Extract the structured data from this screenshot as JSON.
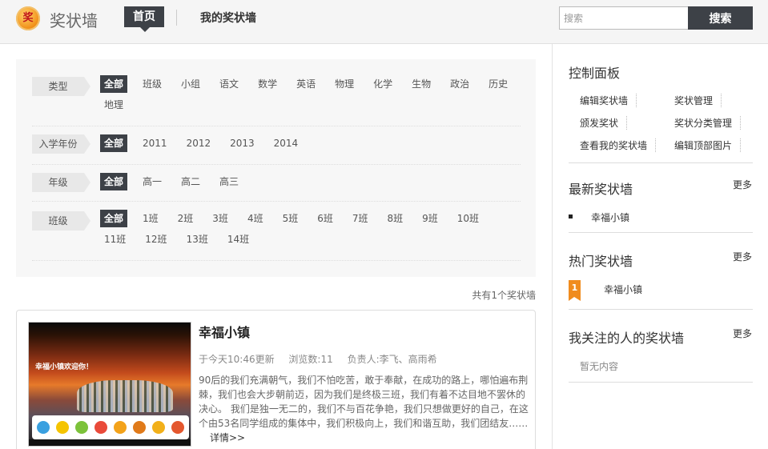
{
  "header": {
    "logo_glyph": "奖",
    "brand": "奖状墙",
    "nav": {
      "home": "首页",
      "mine": "我的奖状墙"
    },
    "search": {
      "placeholder": "搜索",
      "button": "搜索"
    }
  },
  "filters": [
    {
      "label": "类型",
      "options": [
        "全部",
        "班级",
        "小组",
        "语文",
        "数学",
        "英语",
        "物理",
        "化学",
        "生物",
        "政治",
        "历史",
        "地理"
      ],
      "active": 0
    },
    {
      "label": "入学年份",
      "options": [
        "全部",
        "2011",
        "2012",
        "2013",
        "2014"
      ],
      "active": 0
    },
    {
      "label": "年级",
      "options": [
        "全部",
        "高一",
        "高二",
        "高三"
      ],
      "active": 0
    },
    {
      "label": "班级",
      "options": [
        "全部",
        "1班",
        "2班",
        "3班",
        "4班",
        "5班",
        "6班",
        "7班",
        "8班",
        "9班",
        "10班",
        "11班",
        "12班",
        "13班",
        "14班"
      ],
      "active": 0
    }
  ],
  "result_count": "共有1个奖状墙",
  "card": {
    "title": "幸福小镇",
    "updated": "于今天10:46更新",
    "views": "浏览数:11",
    "owners": "负责人:李飞、高雨希",
    "thumb_text": "幸福小镇欢迎你！",
    "description": "90后的我们充满朝气，我们不怕吃苦，敢于奉献，在成功的路上，哪怕遍布荆棘，我们也会大步朝前迈，因为我们是终极三班，我们有着不达目地不罢休的决心。 我们是独一无二的，我们不与百花争艳，我们只想做更好的自己，在这个由53名同学组成的集体中，我们积极向上，我们和谐互助，我们团结友……",
    "more": "详情>>"
  },
  "sidebar": {
    "control_panel": {
      "title": "控制面板",
      "items": [
        "编辑奖状墙",
        "奖状管理",
        "颁发奖状",
        "奖状分类管理",
        "查看我的奖状墙",
        "编辑顶部图片"
      ]
    },
    "latest": {
      "title": "最新奖状墙",
      "more": "更多",
      "items": [
        "幸福小镇"
      ]
    },
    "hot": {
      "title": "热门奖状墙",
      "more": "更多",
      "items": [
        {
          "rank": "1",
          "name": "幸福小镇"
        }
      ]
    },
    "following": {
      "title": "我关注的人的奖状墙",
      "more": "更多",
      "empty": "暂无内容"
    }
  },
  "colors": {
    "dark": "#3d4147",
    "accent": "#f08c1e"
  }
}
